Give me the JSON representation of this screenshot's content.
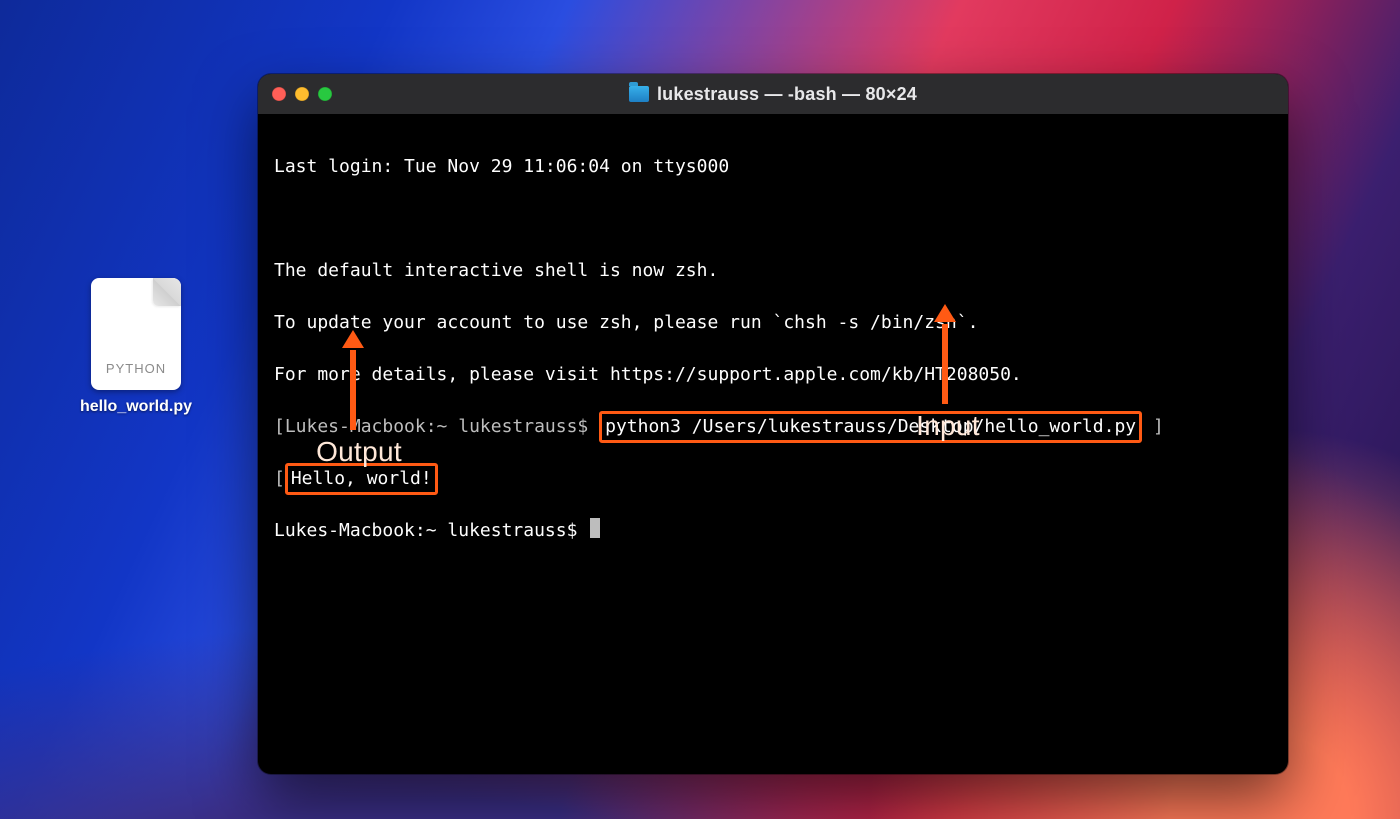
{
  "desktop": {
    "file": {
      "type_badge": "PYTHON",
      "filename": "hello_world.py"
    }
  },
  "terminal": {
    "window_title": "lukestrauss — -bash — 80×24",
    "lines": {
      "last_login": "Last login: Tue Nov 29 11:06:04 on ttys000",
      "blank": " ",
      "zsh_notice": "The default interactive shell is now zsh.",
      "zsh_update": "To update your account to use zsh, please run `chsh -s /bin/zsh`.",
      "zsh_details": "For more details, please visit https://support.apple.com/kb/HT208050.",
      "prompt1_prefix": "[Lukes-Macbook:~ lukestrauss$ ",
      "prompt1_command": "python3 /Users/lukestrauss/Desktop/hello_world.py",
      "prompt1_suffix": " ]",
      "output": "Hello, world!",
      "prompt2_open": "[",
      "prompt2_prefix": "Lukes-Macbook:~ lukestrauss$ "
    }
  },
  "annotations": {
    "output_label": "Output",
    "input_label": "Input"
  },
  "colors": {
    "highlight": "#ff5a14",
    "titlebar": "#2c2c2e"
  }
}
